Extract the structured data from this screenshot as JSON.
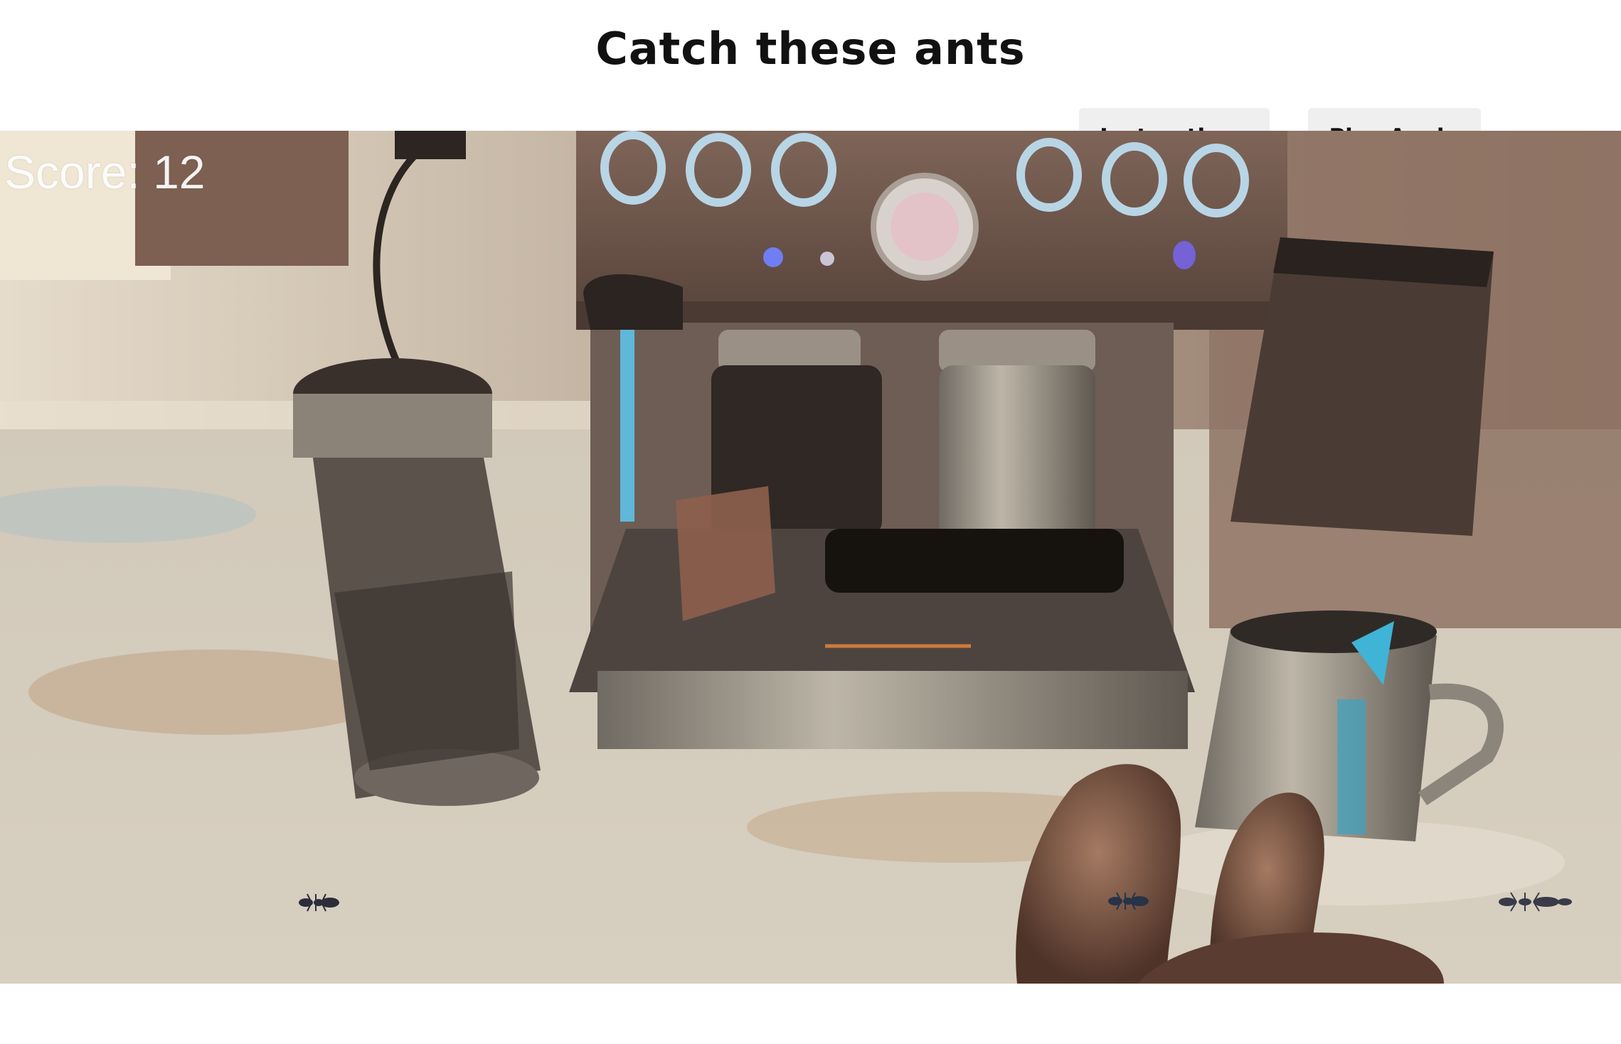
{
  "title": "Catch these ants",
  "buttons": {
    "instructions_label": "Instructions",
    "play_again_label": "Play Again"
  },
  "game": {
    "score_label": "Score: 12"
  },
  "colors": {
    "counter": "#cbc2b3",
    "machine": "#7a6155",
    "machine_dark": "#3b2f2a",
    "accent_blue": "#5fb7d9",
    "cat_fur": "#6b4a3c",
    "button_bg": "#efefef"
  }
}
